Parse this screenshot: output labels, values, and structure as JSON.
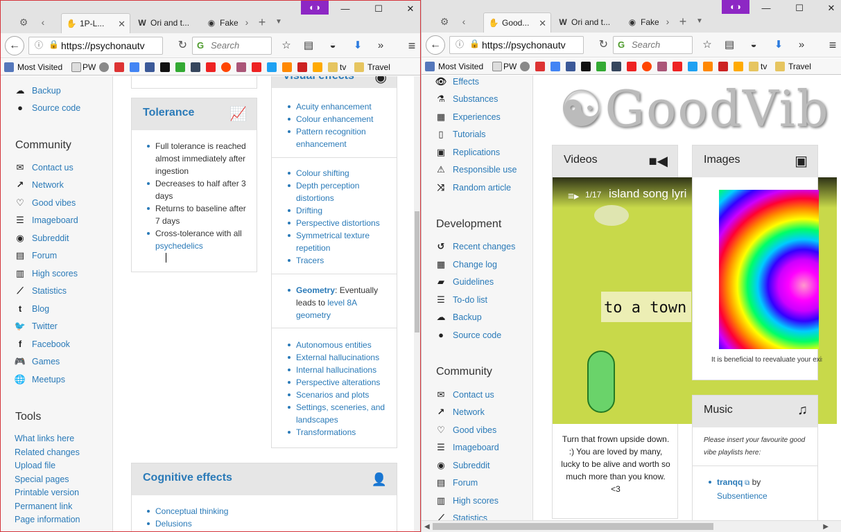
{
  "left": {
    "tabs": [
      "1P-L...",
      "Ori and t...",
      "Fake"
    ],
    "url": "https://psychonautv",
    "search_placeholder": "Search",
    "bookmarks": [
      "Most Visited",
      "PW",
      "tv",
      "Travel"
    ],
    "sidebar": {
      "top_items": [
        {
          "label": "Backup",
          "icon": "cloud-upload-icon"
        },
        {
          "label": "Source code",
          "icon": "github-icon"
        }
      ],
      "community_title": "Community",
      "community": [
        {
          "label": "Contact us",
          "icon": "envelope-icon"
        },
        {
          "label": "Network",
          "icon": "external-link-icon"
        },
        {
          "label": "Good vibes",
          "icon": "heart-icon"
        },
        {
          "label": "Imageboard",
          "icon": "list-icon"
        },
        {
          "label": "Subreddit",
          "icon": "reddit-icon"
        },
        {
          "label": "Forum",
          "icon": "forum-icon"
        },
        {
          "label": "High scores",
          "icon": "bar-chart-icon"
        },
        {
          "label": "Statistics",
          "icon": "line-chart-icon"
        },
        {
          "label": "Blog",
          "icon": "tumblr-icon"
        },
        {
          "label": "Twitter",
          "icon": "twitter-icon"
        },
        {
          "label": "Facebook",
          "icon": "facebook-icon"
        },
        {
          "label": "Games",
          "icon": "gamepad-icon"
        },
        {
          "label": "Meetups",
          "icon": "globe-icon"
        }
      ],
      "tools_title": "Tools",
      "tools": [
        "What links here",
        "Related changes",
        "Upload file",
        "Special pages",
        "Printable version",
        "Permanent link",
        "Page information"
      ]
    },
    "tolerance": {
      "title": "Tolerance",
      "items": [
        "Full tolerance is reached almost immediately after ingestion",
        "Decreases to half after 3 days",
        "Returns to baseline after 7 days",
        "Cross-tolerance with all"
      ],
      "link": "psychedelics"
    },
    "visual_effects": {
      "title": "Visual effects",
      "group1": [
        "Acuity enhancement",
        "Colour enhancement",
        "Pattern recognition enhancement"
      ],
      "group2": [
        "Colour shifting",
        "Depth perception distortions",
        "Drifting",
        "Perspective distortions",
        "Symmetrical texture repetition",
        "Tracers"
      ],
      "geometry_link": "Geometry",
      "geometry_text": ": Eventually leads to ",
      "geometry_level": "level 8A geometry",
      "group4": [
        "Autonomous entities",
        "External hallucinations",
        "Internal hallucinations",
        "Perspective alterations",
        "Scenarios and plots",
        "Settings, sceneries, and landscapes",
        "Transformations"
      ]
    },
    "cognitive": {
      "title": "Cognitive effects",
      "items": [
        "Conceptual thinking",
        "Delusions"
      ]
    }
  },
  "right": {
    "tabs": [
      "Good...",
      "Ori and t...",
      "Fake"
    ],
    "url": "https://psychonautv",
    "search_placeholder": "Search",
    "bookmarks": [
      "Most Visited",
      "PW",
      "tv",
      "Travel"
    ],
    "sidebar": {
      "top_items": [
        {
          "label": "Effects",
          "icon": "eye-icon"
        },
        {
          "label": "Substances",
          "icon": "flask-icon"
        },
        {
          "label": "Experiences",
          "icon": "newspaper-icon"
        },
        {
          "label": "Tutorials",
          "icon": "book-icon"
        },
        {
          "label": "Replications",
          "icon": "image-icon"
        },
        {
          "label": "Responsible use",
          "icon": "warning-icon"
        },
        {
          "label": "Random article",
          "icon": "random-icon"
        }
      ],
      "development_title": "Development",
      "development": [
        {
          "label": "Recent changes",
          "icon": "history-icon"
        },
        {
          "label": "Change log",
          "icon": "calendar-icon"
        },
        {
          "label": "Guidelines",
          "icon": "book-icon"
        },
        {
          "label": "To-do list",
          "icon": "tasks-icon"
        },
        {
          "label": "Backup",
          "icon": "cloud-upload-icon"
        },
        {
          "label": "Source code",
          "icon": "github-icon"
        }
      ],
      "community_title": "Community",
      "community": [
        {
          "label": "Contact us",
          "icon": "envelope-icon"
        },
        {
          "label": "Network",
          "icon": "external-link-icon"
        },
        {
          "label": "Good vibes",
          "icon": "heart-icon"
        },
        {
          "label": "Imageboard",
          "icon": "list-icon"
        },
        {
          "label": "Subreddit",
          "icon": "reddit-icon"
        },
        {
          "label": "Forum",
          "icon": "forum-icon"
        },
        {
          "label": "High scores",
          "icon": "bar-chart-icon"
        },
        {
          "label": "Statistics",
          "icon": "line-chart-icon"
        }
      ]
    },
    "logo_text": "GoodVib",
    "videos": {
      "title": "Videos",
      "playlist_count": "1/17",
      "video_title": "island song lyri",
      "caption_text": "to a town",
      "description": "Turn that frown upside down. :) You are loved by many, lucky to be alive and worth so much more than you know. <3"
    },
    "images": {
      "title": "Images",
      "caption": "It is beneficial to reevaluate your exis"
    },
    "music": {
      "title": "Music",
      "note": "Please insert your favourite good vibe playlists here:",
      "link": "tranqq",
      "by": " by",
      "author": "Subsentience"
    }
  },
  "colors": {
    "link": "#2a7ab8",
    "mask_purple": "#8d27c4",
    "window_border": "#d4343b"
  }
}
